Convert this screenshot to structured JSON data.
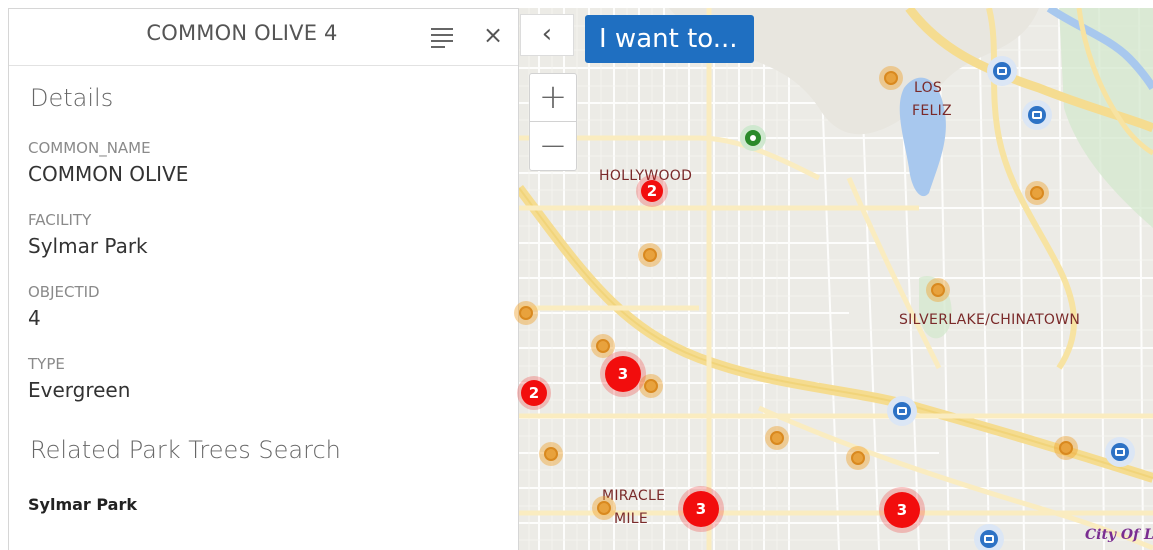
{
  "panel": {
    "title": "COMMON OLIVE 4",
    "details_heading": "Details",
    "fields": [
      {
        "label": "COMMON_NAME",
        "value": "COMMON OLIVE"
      },
      {
        "label": "FACILITY",
        "value": "Sylmar Park"
      },
      {
        "label": "OBJECTID",
        "value": "4"
      },
      {
        "label": "TYPE",
        "value": "Evergreen"
      }
    ],
    "related_heading": "Related Park Trees Search",
    "related_link": "Sylmar Park",
    "icons": {
      "menu": "list-menu-icon",
      "close": "close-icon"
    },
    "close_glyph": "×"
  },
  "map": {
    "collapse_glyph": "‹",
    "iwant_label": "I want to...",
    "zoom_in": "+",
    "zoom_out": "−",
    "labels": [
      "LOS",
      "FELIZ",
      "HOLLYWOOD",
      "SILVERLAKE/CHINATOWN",
      "MIRACLE",
      "MILE",
      "City Of Lo"
    ],
    "clusters": [
      "2",
      "2",
      "3",
      "3",
      "3"
    ],
    "colors": {
      "point": "#e8a23d",
      "cluster": "#f20d0d",
      "camera": "#2d72c5",
      "selected": "#2a8a2a",
      "button": "#1f6fc1"
    }
  }
}
